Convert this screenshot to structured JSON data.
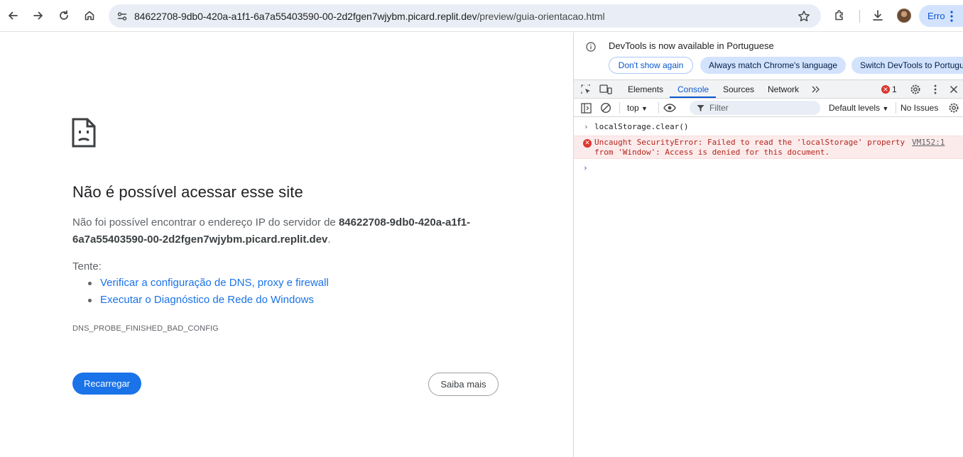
{
  "browser": {
    "url_host": "84622708-9db0-420a-a1f1-6a7a55403590-00-2d2fgen7wjybm.picard.replit.dev",
    "url_path": "/preview/guia-orientacao.html",
    "profile_label": "Erro",
    "icons": [
      "back-icon",
      "forward-icon",
      "reload-icon",
      "home-icon",
      "site-info-icon",
      "star-icon",
      "extensions-icon",
      "download-icon",
      "avatar",
      "more-icon"
    ]
  },
  "error_page": {
    "title": "Não é possível acessar esse site",
    "desc_prefix": "Não foi possível encontrar o endereço IP do servidor de ",
    "desc_host_line1": "84622708-9db0-420a-a1f1-",
    "desc_host_line2": "6a7a55403590-00-2d2fgen7wjybm.picard.replit.dev",
    "desc_suffix": ".",
    "try_label": "Tente:",
    "suggestions": [
      "Verificar a configuração de DNS, proxy e firewall",
      "Executar o Diagnóstico de Rede do Windows"
    ],
    "error_code": "DNS_PROBE_FINISHED_BAD_CONFIG",
    "reload_label": "Recarregar",
    "more_label": "Saiba mais"
  },
  "devtools": {
    "infobar": {
      "message": "DevTools is now available in Portuguese",
      "dont_show": "Don't show again",
      "always_match": "Always match Chrome's language",
      "switch": "Switch DevTools to Portuguese"
    },
    "tabs": [
      "Elements",
      "Console",
      "Sources",
      "Network"
    ],
    "active_tab": "Console",
    "error_count": "1",
    "filterbar": {
      "context": "top",
      "filter_placeholder": "Filter",
      "levels": "Default levels",
      "issues": "No Issues"
    },
    "console": {
      "input": "localStorage.clear()",
      "error_message": "Uncaught SecurityError: Failed to read the 'localStorage' property\nfrom 'Window': Access is denied for this document.",
      "error_source": "VM152:1"
    },
    "colors": {
      "accent": "#0b57d0",
      "error": "#dc362e",
      "error_bg": "#fcebeb"
    }
  }
}
